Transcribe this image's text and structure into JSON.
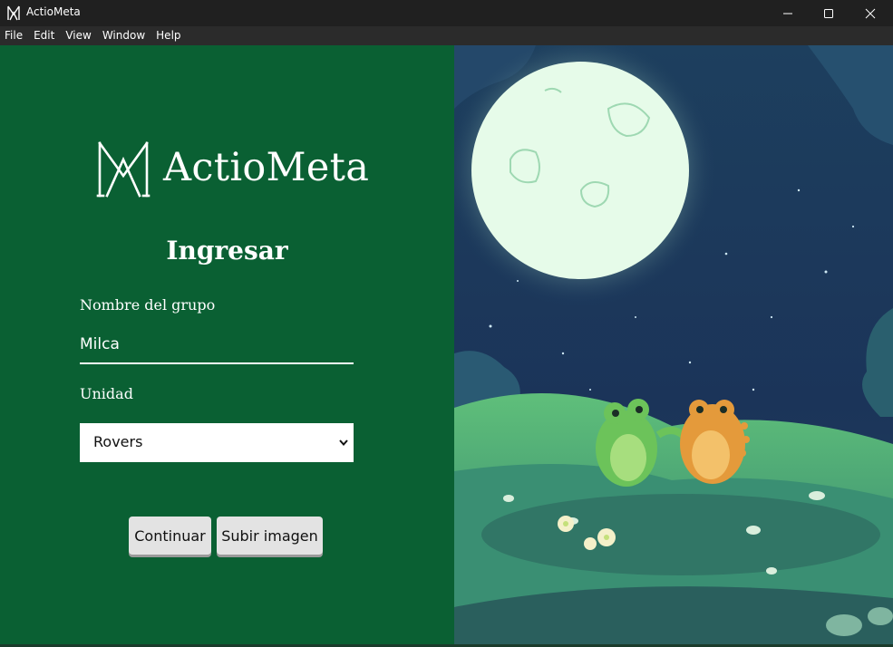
{
  "window": {
    "title": "ActioMeta",
    "icon": "actiometa-logo-icon",
    "controls": [
      "minimize-icon",
      "maximize-icon",
      "close-icon"
    ]
  },
  "menu": [
    "File",
    "Edit",
    "View",
    "Window",
    "Help"
  ],
  "brand": {
    "name": "ActioMeta"
  },
  "form": {
    "heading": "Ingresar",
    "group_label": "Nombre del grupo",
    "group_value": "Milca",
    "unit_label": "Unidad",
    "unit_selected": "Rovers"
  },
  "buttons": {
    "continue": "Continuar",
    "upload": "Subir imagen"
  },
  "colors": {
    "panel_green": "#0a6033",
    "night_sky": "#1d3a5c",
    "moon": "#e6fbe9",
    "grass": "#3f9a77",
    "frog_green": "#6cc35a",
    "frog_orange": "#e49a3b"
  }
}
